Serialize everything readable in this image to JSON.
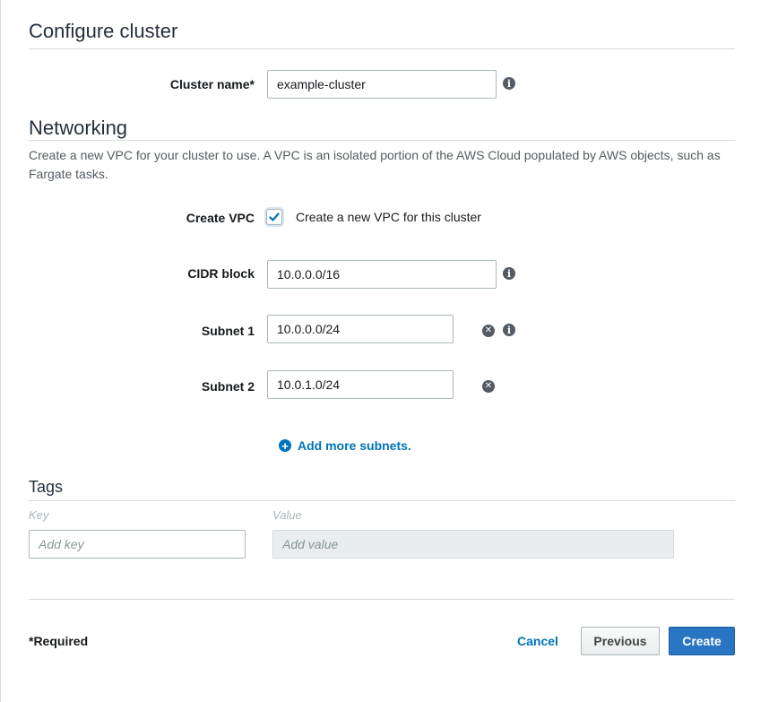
{
  "configure": {
    "title": "Configure cluster",
    "cluster_name_label": "Cluster name*",
    "cluster_name_value": "example-cluster"
  },
  "networking": {
    "title": "Networking",
    "description": "Create a new VPC for your cluster to use. A VPC is an isolated portion of the AWS Cloud populated by AWS objects, such as Fargate tasks.",
    "create_vpc_label": "Create VPC",
    "create_vpc_checked": true,
    "create_vpc_text": "Create a new VPC for this cluster",
    "cidr_label": "CIDR block",
    "cidr_value": "10.0.0.0/16",
    "subnets": [
      {
        "label": "Subnet 1",
        "value": "10.0.0.0/24"
      },
      {
        "label": "Subnet 2",
        "value": "10.0.1.0/24"
      }
    ],
    "add_subnets_label": "Add more subnets."
  },
  "tags": {
    "title": "Tags",
    "key_header": "Key",
    "value_header": "Value",
    "key_placeholder": "Add key",
    "value_placeholder": "Add value"
  },
  "footer": {
    "required_note": "*Required",
    "cancel_label": "Cancel",
    "previous_label": "Previous",
    "create_label": "Create"
  },
  "colors": {
    "primary": "#2a74c4",
    "link": "#0073bb",
    "divider": "#d5dbdb"
  },
  "icons": {
    "info": "info-icon",
    "remove": "remove-icon",
    "add": "plus-circle-icon",
    "check": "checkmark-icon"
  }
}
